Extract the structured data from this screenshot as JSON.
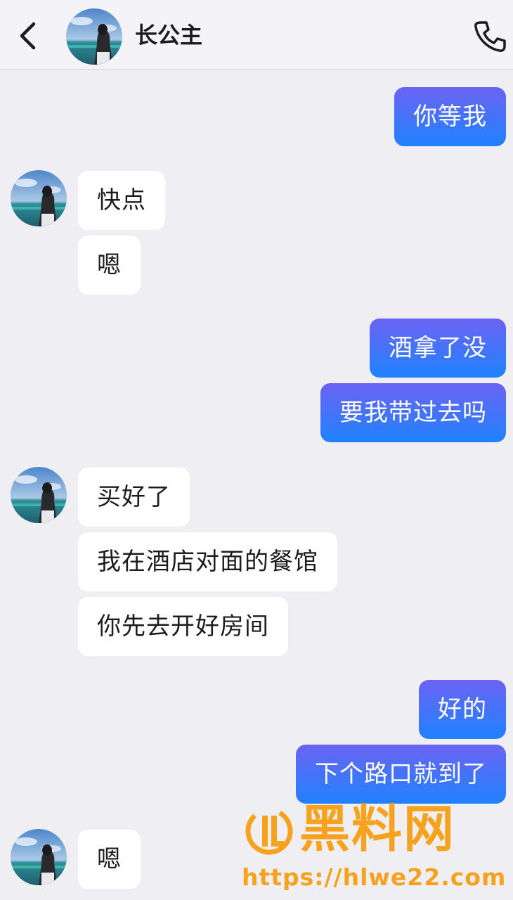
{
  "header": {
    "contact_name": "长公主",
    "back_icon": "chevron-left-icon",
    "call_icon": "phone-icon"
  },
  "colors": {
    "background": "#efeef3",
    "incoming_bubble": "#ffffff",
    "outgoing_gradient_top": "#6b63f2",
    "outgoing_gradient_bottom": "#1f82ff",
    "watermark": "#f6a21c"
  },
  "messages": [
    {
      "sender": "me",
      "text": "你等我"
    },
    {
      "sender": "contact",
      "text": "快点"
    },
    {
      "sender": "contact",
      "text": "嗯"
    },
    {
      "sender": "me",
      "text": "酒拿了没"
    },
    {
      "sender": "me",
      "text": "要我带过去吗"
    },
    {
      "sender": "contact",
      "text": "买好了"
    },
    {
      "sender": "contact",
      "text": "我在酒店对面的餐馆"
    },
    {
      "sender": "contact",
      "text": "你先去开好房间"
    },
    {
      "sender": "me",
      "text": "好的"
    },
    {
      "sender": "me",
      "text": "下个路口就到了"
    },
    {
      "sender": "contact",
      "text": "嗯"
    }
  ],
  "watermark": {
    "title": "黑料网",
    "url": "https://hlwe22.com"
  }
}
